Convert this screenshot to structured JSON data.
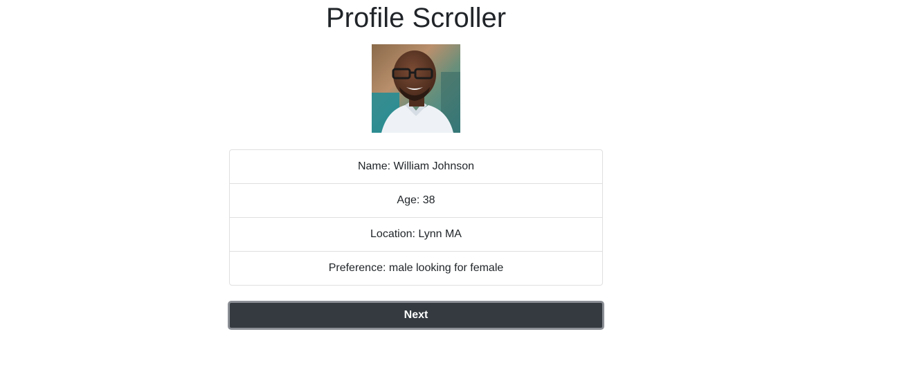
{
  "page": {
    "title": "Profile Scroller"
  },
  "profile": {
    "photo_icon": "profile-photo",
    "fields": [
      "Name: William Johnson",
      "Age: 38",
      "Location: Lynn MA",
      "Preference: male looking for female"
    ]
  },
  "actions": {
    "next_label": "Next"
  },
  "colors": {
    "button_bg": "#343a40",
    "button_border": "#8c9096",
    "text": "#212529",
    "border": "#dfdfdf"
  }
}
